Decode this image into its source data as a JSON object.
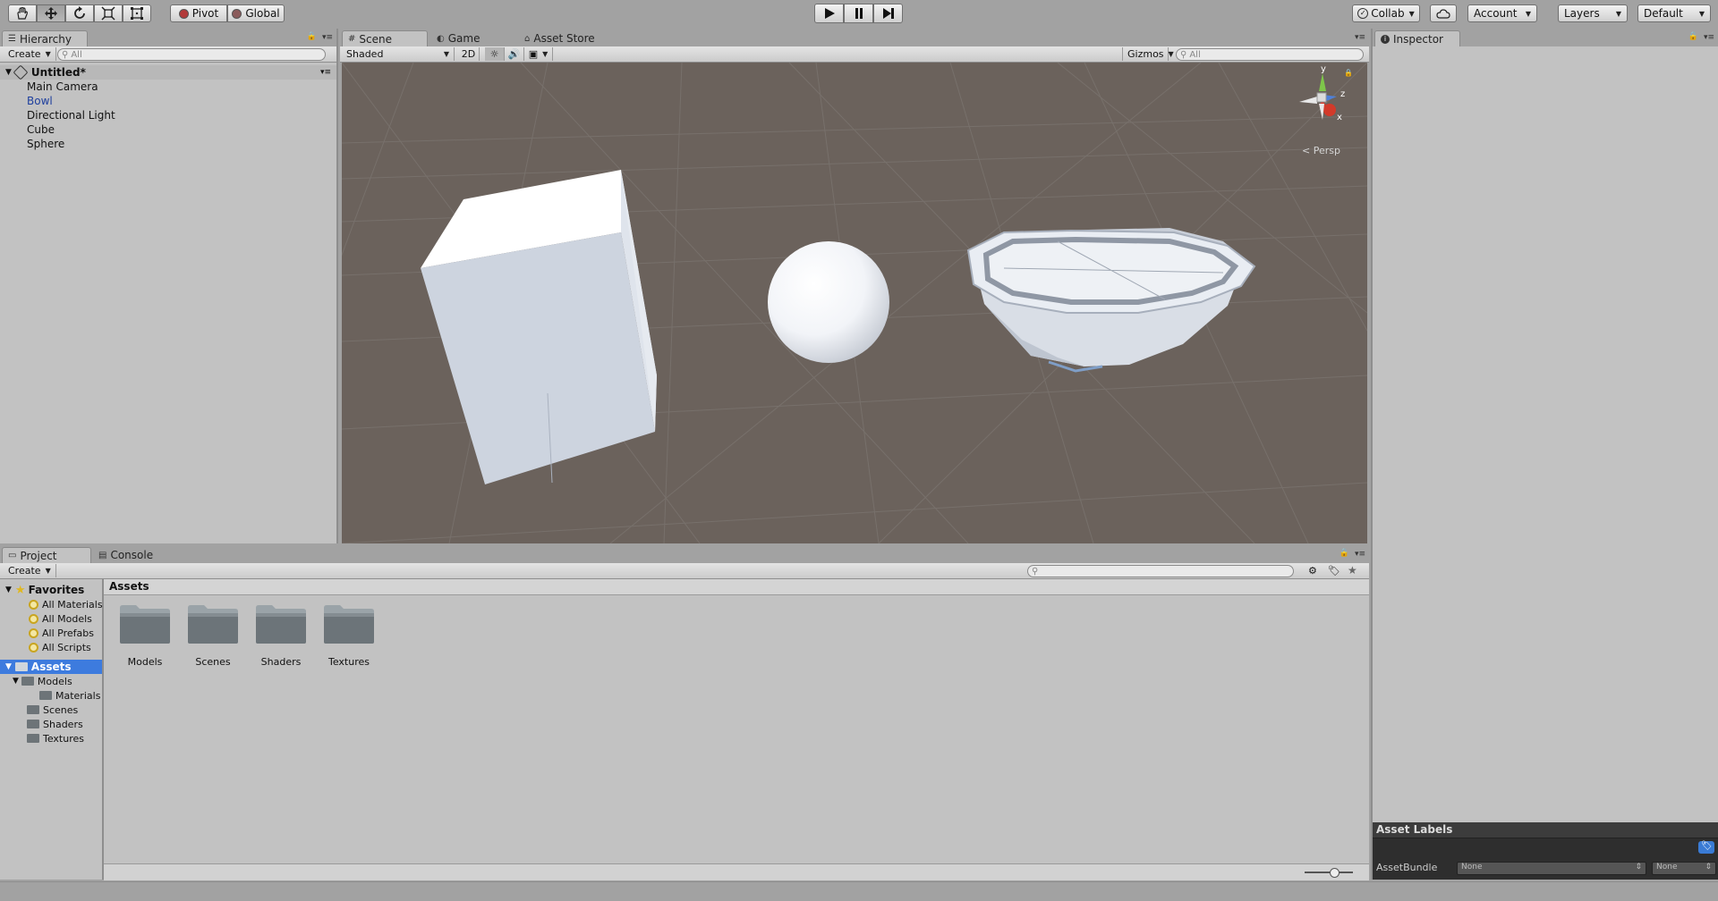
{
  "toolbar": {
    "tools": [
      "hand-tool-icon",
      "move-tool-icon",
      "rotate-tool-icon",
      "scale-tool-icon",
      "rect-tool-icon"
    ],
    "pivot_label": "Pivot",
    "global_label": "Global",
    "collab_label": "Collab",
    "account_label": "Account",
    "layers_label": "Layers",
    "layout_label": "Default"
  },
  "hierarchy": {
    "tab_label": "Hierarchy",
    "create_label": "Create",
    "search_placeholder": "All",
    "scene_name": "Untitled*",
    "items": [
      "Main Camera",
      "Bowl",
      "Directional Light",
      "Cube",
      "Sphere"
    ],
    "selected": "Bowl"
  },
  "scene_view": {
    "tabs": [
      "Scene",
      "Game",
      "Asset Store"
    ],
    "active_tab": "Scene",
    "shading_mode": "Shaded",
    "mode_2d_label": "2D",
    "gizmos_label": "Gizmos",
    "search_placeholder": "All",
    "projection_label": "Persp",
    "axis_labels": {
      "x": "x",
      "y": "y",
      "z": "z"
    }
  },
  "inspector": {
    "tab_label": "Inspector",
    "asset_labels_title": "Asset Labels",
    "asset_bundle_label": "AssetBundle",
    "asset_bundle_value": "None",
    "asset_bundle_variant": "None"
  },
  "project": {
    "tabs": [
      "Project",
      "Console"
    ],
    "create_label": "Create",
    "favorites_label": "Favorites",
    "favorites": [
      "All Materials",
      "All Models",
      "All Prefabs",
      "All Scripts"
    ],
    "assets_label": "Assets",
    "tree": [
      {
        "label": "Models",
        "depth": 1,
        "expanded": true
      },
      {
        "label": "Materials",
        "depth": 2
      },
      {
        "label": "Scenes",
        "depth": 1
      },
      {
        "label": "Shaders",
        "depth": 1
      },
      {
        "label": "Textures",
        "depth": 1
      }
    ],
    "breadcrumb": "Assets",
    "folders": [
      "Models",
      "Scenes",
      "Shaders",
      "Textures"
    ]
  },
  "colors": {
    "selection": "#3d7bde",
    "hierarchy_selected_text": "#1e3f9e",
    "scene_background": "#6b625c"
  }
}
